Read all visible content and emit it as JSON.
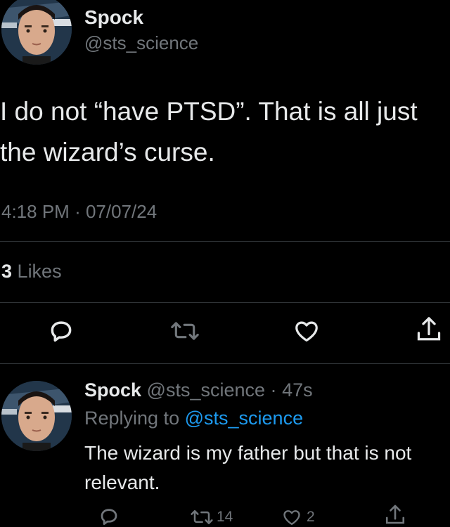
{
  "main_tweet": {
    "author_name": "Spock",
    "author_handle": "@sts_science",
    "text_line1": "I do not “have PTSD”. That is all just",
    "text_line2": "the wizard’s curse.",
    "time": "4:18 PM",
    "separator": "·",
    "date": "07/07/24",
    "likes_count": "3",
    "likes_label": "Likes"
  },
  "actions": {
    "reply_icon": "reply-icon",
    "retweet_icon": "retweet-icon",
    "like_icon": "heart-icon",
    "share_icon": "share-icon"
  },
  "reply": {
    "author_name": "Spock",
    "author_handle": "@sts_science",
    "separator": "·",
    "age": "47s",
    "replying_prefix": "Replying to",
    "replying_handle": "@sts_science",
    "text_line1": "The wizard is my father but that is not",
    "text_line2": "relevant.",
    "retweet_count": "14",
    "like_count": "2"
  },
  "colors": {
    "background": "#000000",
    "text": "#e7e9ea",
    "muted": "#71767b",
    "link": "#1d9bf0",
    "divider": "#2f3336"
  }
}
